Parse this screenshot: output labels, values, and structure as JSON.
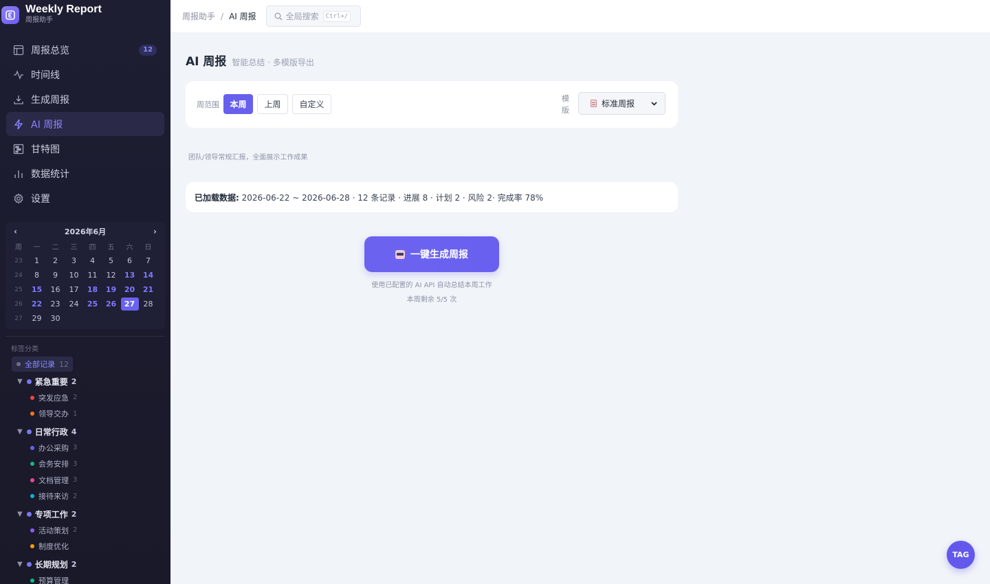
{
  "app": {
    "title": "Weekly Report",
    "subtitle": "周报助手"
  },
  "nav": [
    {
      "label": "周报总览",
      "icon": "layout-icon",
      "badge": "12",
      "active": false
    },
    {
      "label": "时间线",
      "icon": "activity-icon",
      "active": false
    },
    {
      "label": "生成周报",
      "icon": "download-icon",
      "active": false
    },
    {
      "label": "AI 周报",
      "icon": "lightning-icon",
      "active": true
    },
    {
      "label": "甘特图",
      "icon": "gantt-icon",
      "active": false
    },
    {
      "label": "数据统计",
      "icon": "bar-chart-icon",
      "active": false
    },
    {
      "label": "设置",
      "icon": "gear-icon",
      "active": false
    }
  ],
  "calendar": {
    "title": "2026年6月",
    "prev": "‹",
    "next": "›",
    "headers": [
      "周",
      "一",
      "二",
      "三",
      "四",
      "五",
      "六",
      "日"
    ],
    "rows": [
      {
        "week": "23",
        "days": [
          "1",
          "2",
          "3",
          "4",
          "5",
          "6",
          "7"
        ]
      },
      {
        "week": "24",
        "days": [
          "8",
          "9",
          "10",
          "11",
          "12",
          "13",
          "14"
        ]
      },
      {
        "week": "25",
        "days": [
          "15",
          "16",
          "17",
          "18",
          "19",
          "20",
          "21"
        ]
      },
      {
        "week": "26",
        "days": [
          "22",
          "23",
          "24",
          "25",
          "26",
          "27",
          "28"
        ]
      },
      {
        "week": "27",
        "days": [
          "29",
          "30",
          "",
          "",
          "",
          "",
          ""
        ]
      }
    ],
    "highlighted": [
      "13",
      "14",
      "15",
      "18",
      "19",
      "20",
      "21",
      "22",
      "25",
      "26"
    ],
    "today": "27"
  },
  "tags": {
    "title": "标签分类",
    "all": {
      "label": "全部记录",
      "count": "12"
    },
    "groups": [
      {
        "label": "紧急重要",
        "count": "2",
        "children": [
          {
            "label": "突发应急",
            "count": "2",
            "color": "#ef4444"
          },
          {
            "label": "领导交办",
            "count": "1",
            "color": "#f97316"
          }
        ]
      },
      {
        "label": "日常行政",
        "count": "4",
        "children": [
          {
            "label": "办公采购",
            "count": "3",
            "color": "#6366f1"
          },
          {
            "label": "会务安排",
            "count": "3",
            "color": "#10b981"
          },
          {
            "label": "文档管理",
            "count": "3",
            "color": "#ec4899"
          },
          {
            "label": "接待来访",
            "count": "2",
            "color": "#06b6d4"
          }
        ]
      },
      {
        "label": "专项工作",
        "count": "2",
        "children": [
          {
            "label": "活动策划",
            "count": "2",
            "color": "#8b5cf6"
          },
          {
            "label": "制度优化",
            "count": "",
            "color": "#f59e0b"
          }
        ]
      },
      {
        "label": "长期规划",
        "count": "2",
        "children": [
          {
            "label": "预算管理",
            "count": "",
            "color": "#10b981"
          }
        ]
      }
    ]
  },
  "topbar": {
    "breadcrumb": [
      "周报助手",
      "AI 周报"
    ],
    "separator": "/",
    "search_placeholder": "全局搜索",
    "search_shortcut": "Ctrl+/"
  },
  "page": {
    "title": "AI 周报",
    "subtitle": "智能总结 · 多模版导出",
    "range_label": "周范围",
    "ranges": [
      {
        "label": "本周",
        "active": true
      },
      {
        "label": "上周",
        "active": false
      },
      {
        "label": "自定义",
        "active": false
      }
    ],
    "template_label": "模版",
    "template_value": "标准周报",
    "template_hint": "团队/领导常规汇报，全面展示工作成果",
    "loaded_label": "已加载数据:",
    "loaded_text": "2026-06-22 ~ 2026-06-28 · 12 条记录 · 进展 8 · 计划 2 · 风险 2· 完成率 78%",
    "generate_label": "一键生成周报",
    "generate_note": "使用已配置的 AI API 自动总结本周工作",
    "remaining": "本周剩余 5/5 次"
  },
  "fab": {
    "label": "TAG"
  },
  "colors": {
    "accent": "#6760ee",
    "sidebar_bg": "#1e1e33",
    "main_bg": "#f1f4f9"
  }
}
